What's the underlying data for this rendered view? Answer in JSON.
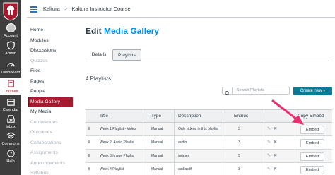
{
  "global_nav": {
    "items": [
      {
        "label": "Account",
        "icon": "avatar"
      },
      {
        "label": "Admin",
        "icon": "shield-icon"
      },
      {
        "label": "Dashboard",
        "icon": "dashboard-icon"
      },
      {
        "label": "Courses",
        "icon": "book-icon",
        "active": true
      },
      {
        "label": "Calendar",
        "icon": "calendar-icon"
      },
      {
        "label": "Inbox",
        "icon": "inbox-icon"
      },
      {
        "label": "Commons",
        "icon": "commons-icon"
      },
      {
        "label": "Help",
        "icon": "help-icon"
      }
    ]
  },
  "breadcrumb": {
    "root": "Kaltura",
    "separator": ">",
    "course": "Kaltura Instructor Course"
  },
  "course_nav": {
    "items": [
      {
        "label": "Home",
        "dim": false
      },
      {
        "label": "Modules",
        "dim": false
      },
      {
        "label": "Discussions",
        "dim": false
      },
      {
        "label": "Quizzes",
        "dim": true
      },
      {
        "label": "Files",
        "dim": false
      },
      {
        "label": "Pages",
        "dim": false
      },
      {
        "label": "People",
        "dim": false
      },
      {
        "label": "Media Gallery",
        "dim": false,
        "active": true
      },
      {
        "label": "My Media",
        "dim": false
      },
      {
        "label": "Conferences",
        "dim": true
      },
      {
        "label": "Outcomes",
        "dim": true
      },
      {
        "label": "Collaborations",
        "dim": true
      },
      {
        "label": "Assignments",
        "dim": true
      },
      {
        "label": "Announcements",
        "dim": true
      },
      {
        "label": "Syllabus",
        "dim": true
      }
    ]
  },
  "page": {
    "title_prefix": "Edit",
    "title_accent": "Media Gallery",
    "tabs": [
      "Details",
      "Playlists"
    ],
    "active_tab": "Playlists",
    "count_label": "4 Playlists",
    "search_placeholder": "Search Playlists",
    "create_label": "Create new ▾"
  },
  "table": {
    "headers": {
      "title": "Title",
      "type": "Type",
      "description": "Description",
      "entries": "Entries",
      "copy_embed": "Copy Embed"
    },
    "rows": [
      {
        "title": "Week 1 Playlist - Video",
        "type": "Manual",
        "description": "Only videos in this playlist",
        "entries": "3",
        "embed": "Embed"
      },
      {
        "title": "Week 2: Audio Playlist",
        "type": "Manual",
        "description": "audio",
        "entries": "3",
        "embed": "Embed"
      },
      {
        "title": "Week 3 Image Playlist",
        "type": "Manual",
        "description": "images",
        "entries": "3",
        "embed": "Embed"
      },
      {
        "title": "Week 4 Playlist",
        "type": "Manual",
        "description": "asdfasdf",
        "entries": "3",
        "embed": "Embed"
      }
    ]
  },
  "colors": {
    "brand_red": "#a6192e",
    "accent_blue": "#008ee2",
    "button_teal": "#0b7a98",
    "annotation_pink": "#e8316e"
  }
}
